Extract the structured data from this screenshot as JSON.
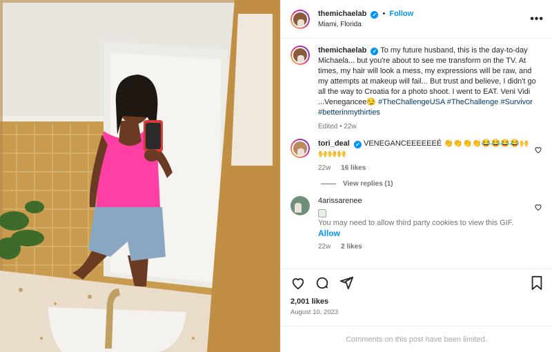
{
  "post": {
    "author": "themichaelab",
    "follow_label": "Follow",
    "location": "Miami, Florida",
    "separator": "•"
  },
  "caption": {
    "author": "themichaelab",
    "text": "To my future husband, this is the day-to-day Michaela... but you're about to see me transform on the TV. At times, my hair will look a mess, my expressions will be raw, and my attempts at makeup will fail... But trust and believe, I didn't go all the way to Croatia for a photo shoot. I went to EAT. Veni Vidi ...Venegancee😏",
    "hashtags": [
      "#TheChallengeUSA",
      "#TheChallenge",
      "#Survivor",
      "#betterinmythirties"
    ],
    "meta": "Edited • 22w"
  },
  "comments": [
    {
      "author": "tori_deal",
      "text": "VENEGANCEEEEEEÉ 👏👏👏👏😂😂😂😂🙌🙌🙌🙌",
      "time": "22w",
      "likes": "16 likes",
      "replies": "View replies (1)"
    },
    {
      "author": "4arissarenee",
      "gif_message": "You may need to allow third party cookies to view this GIF.",
      "allow_label": "Allow",
      "time": "22w",
      "likes": "2 likes"
    }
  ],
  "likes_count": "2,001 likes",
  "post_date": "August 10, 2023",
  "comments_limited": "Comments on this post have been limited.",
  "icons": [
    "verified-icon",
    "more-icon",
    "heart-icon",
    "comment-icon",
    "share-icon",
    "bookmark-icon"
  ],
  "colors": {
    "accent": "#0095f6",
    "hashtag": "#00376b",
    "muted": "#737373",
    "swimsuit": "#ff3fa4"
  }
}
